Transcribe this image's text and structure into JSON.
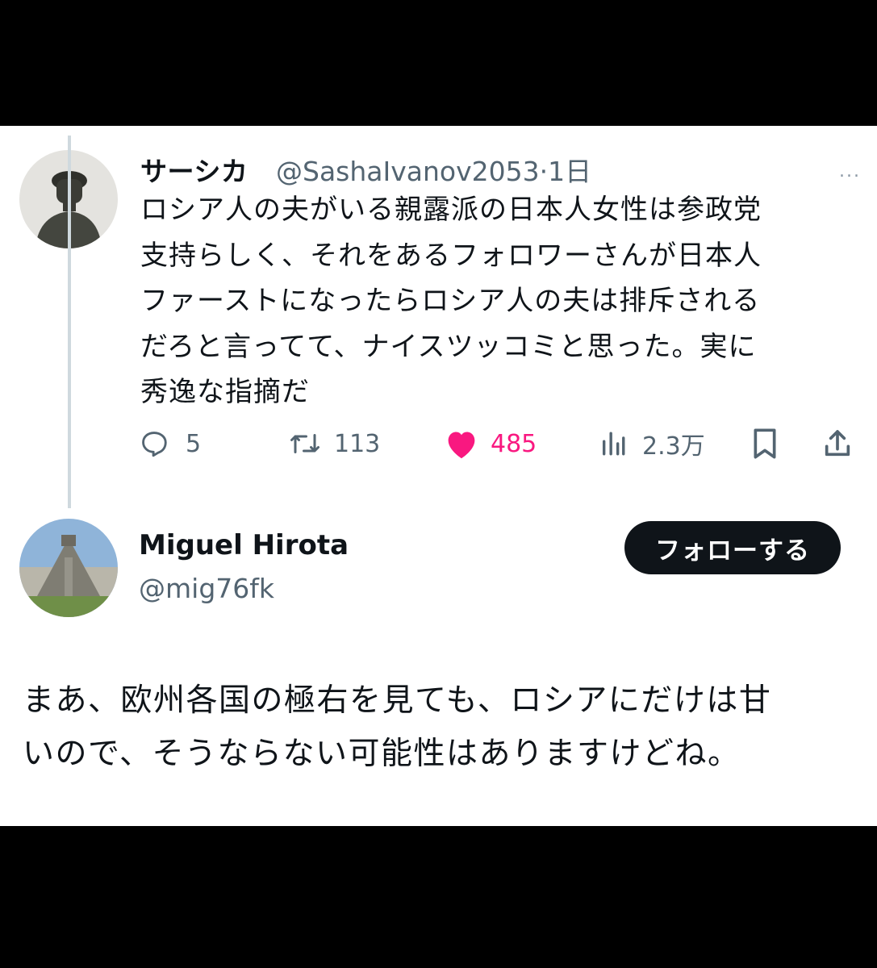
{
  "post": {
    "author_name": "サーシカ",
    "author_handle_time": "@SashaIvanov2053·1日",
    "more_icon": "...",
    "text": "ロシア人の夫がいる親露派の日本人女性は参政党\n支持らしく、それをあるフォロワーさんが日本人\nファーストになったらロシア人の夫は排斥される\nだろと言ってて、ナイスツッコミと思った。実に\n秀逸な指摘だ",
    "actions": {
      "reply_count": "5",
      "repost_count": "113",
      "like_count": "485",
      "view_count": "2.3万"
    },
    "like_color": "#f91880"
  },
  "reply": {
    "author_name": "Miguel Hirota",
    "author_handle": "@mig76fk",
    "follow_label": "フォローする",
    "text": "まあ、欧州各国の極右を見ても、ロシアにだけは甘\nいので、そうならない可能性はありますけどね。"
  }
}
